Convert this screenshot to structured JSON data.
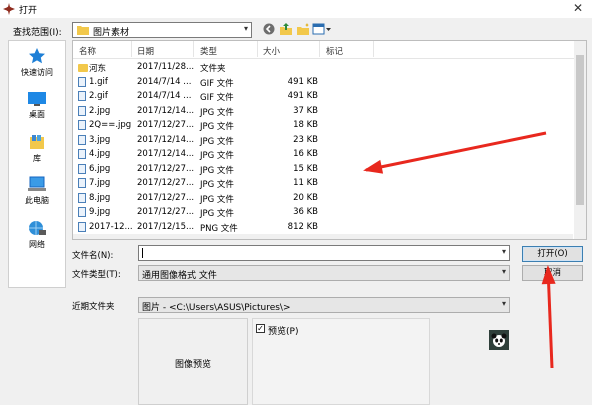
{
  "window": {
    "title": "打开",
    "close_glyph": "✕"
  },
  "look_in": {
    "label": "查找范围(I):",
    "value": "图片素材"
  },
  "toolbar": {
    "back_icon": "back-icon",
    "up_icon": "up-folder-icon",
    "new_folder_icon": "new-folder-icon",
    "view_icon": "view-menu-icon"
  },
  "places": [
    {
      "label": "快速访问",
      "icon": "star-icon"
    },
    {
      "label": "桌面",
      "icon": "desktop-icon"
    },
    {
      "label": "库",
      "icon": "library-icon"
    },
    {
      "label": "此电脑",
      "icon": "computer-icon"
    },
    {
      "label": "网络",
      "icon": "network-icon"
    }
  ],
  "columns": [
    "名称",
    "日期",
    "类型",
    "大小",
    "标记"
  ],
  "files": [
    {
      "name": "河东",
      "date": "2017/11/28...",
      "type": "文件夹",
      "size": "",
      "kind": "folder"
    },
    {
      "name": "1.gif",
      "date": "2014/7/14 ...",
      "type": "GIF 文件",
      "size": "491 KB",
      "kind": "file"
    },
    {
      "name": "2.gif",
      "date": "2014/7/14 ...",
      "type": "GIF 文件",
      "size": "491 KB",
      "kind": "file"
    },
    {
      "name": "2.jpg",
      "date": "2017/12/14...",
      "type": "JPG 文件",
      "size": "37 KB",
      "kind": "file"
    },
    {
      "name": "2Q==.jpg",
      "date": "2017/12/27...",
      "type": "JPG 文件",
      "size": "18 KB",
      "kind": "file"
    },
    {
      "name": "3.jpg",
      "date": "2017/12/14...",
      "type": "JPG 文件",
      "size": "23 KB",
      "kind": "file"
    },
    {
      "name": "4.jpg",
      "date": "2017/12/14...",
      "type": "JPG 文件",
      "size": "16 KB",
      "kind": "file"
    },
    {
      "name": "6.jpg",
      "date": "2017/12/27...",
      "type": "JPG 文件",
      "size": "15 KB",
      "kind": "file"
    },
    {
      "name": "7.jpg",
      "date": "2017/12/27...",
      "type": "JPG 文件",
      "size": "11 KB",
      "kind": "file"
    },
    {
      "name": "8.jpg",
      "date": "2017/12/27...",
      "type": "JPG 文件",
      "size": "20 KB",
      "kind": "file"
    },
    {
      "name": "9.jpg",
      "date": "2017/12/27...",
      "type": "JPG 文件",
      "size": "36 KB",
      "kind": "file"
    },
    {
      "name": "2017-12...",
      "date": "2017/12/15...",
      "type": "PNG 文件",
      "size": "812 KB",
      "kind": "file"
    }
  ],
  "form": {
    "filename_label": "文件名(N):",
    "filename_value": "",
    "filetype_label": "文件类型(T):",
    "filetype_value": "通用图像格式 文件",
    "open_button": "打开(O)",
    "cancel_button": "取消",
    "recent_label": "近期文件夹",
    "recent_value": "图片  -  <C:\\Users\\ASUS\\Pictures\\>",
    "preview_box_label": "图像预览",
    "preview_check_label": "预览(P)",
    "preview_checked": true
  },
  "annotation_color": "#e8281e"
}
